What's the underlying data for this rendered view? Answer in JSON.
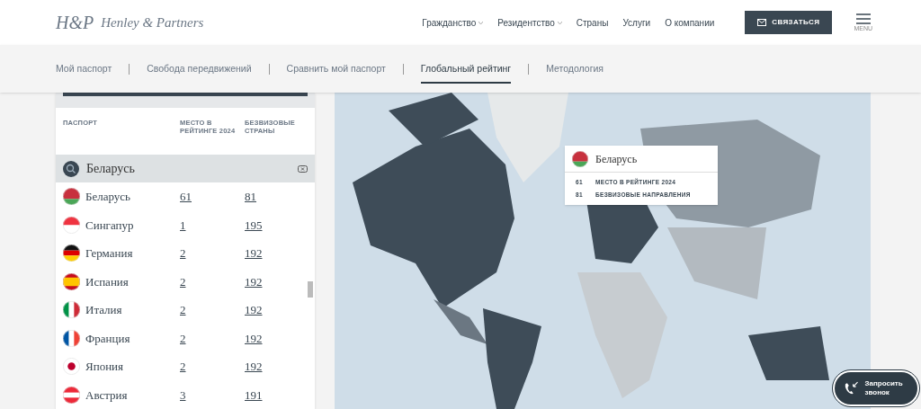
{
  "header": {
    "logo_mark": "H&P",
    "brand": "Henley & Partners",
    "nav": [
      {
        "label": "Гражданство",
        "dropdown": true
      },
      {
        "label": "Резидентство",
        "dropdown": true
      },
      {
        "label": "Страны",
        "dropdown": false
      },
      {
        "label": "Услуги",
        "dropdown": false
      },
      {
        "label": "О компании",
        "dropdown": false
      }
    ],
    "contact_button": "СВЯЗАТЬСЯ",
    "menu_label": "MENU"
  },
  "subnav": [
    {
      "label": "Мой паспорт",
      "selected": false
    },
    {
      "label": "Свобода передвижений",
      "selected": false
    },
    {
      "label": "Сравнить мой паспорт",
      "selected": false
    },
    {
      "label": "Глобальный рейтинг",
      "selected": true
    },
    {
      "label": "Методология",
      "selected": false
    }
  ],
  "table": {
    "columns": [
      "ПАСПОРТ",
      "МЕСТО В РЕЙТИНГЕ 2024",
      "БЕЗВИЗОВЫЕ СТРАНЫ"
    ],
    "search": {
      "value": "Беларусь"
    },
    "rows": [
      {
        "kind": "by",
        "country": "Беларусь",
        "rank": "61",
        "visa_free": "81"
      },
      {
        "kind": "sg",
        "country": "Сингапур",
        "rank": "1",
        "visa_free": "195"
      },
      {
        "kind": "de",
        "country": "Германия",
        "rank": "2",
        "visa_free": "192"
      },
      {
        "kind": "es",
        "country": "Испания",
        "rank": "2",
        "visa_free": "192"
      },
      {
        "kind": "it",
        "country": "Италия",
        "rank": "2",
        "visa_free": "192"
      },
      {
        "kind": "fr",
        "country": "Франция",
        "rank": "2",
        "visa_free": "192"
      },
      {
        "kind": "jp",
        "country": "Япония",
        "rank": "2",
        "visa_free": "192"
      },
      {
        "kind": "at",
        "country": "Австрия",
        "rank": "3",
        "visa_free": "191"
      }
    ]
  },
  "tooltip": {
    "kind": "by",
    "country": "Беларусь",
    "lines": [
      {
        "value": "61",
        "label": "МЕСТО В РЕЙТИНГЕ 2024"
      },
      {
        "value": "81",
        "label": "БЕЗВИЗОВЫЕ НАПРАВЛЕНИЯ"
      }
    ]
  },
  "call_button": "Запросить звонок"
}
